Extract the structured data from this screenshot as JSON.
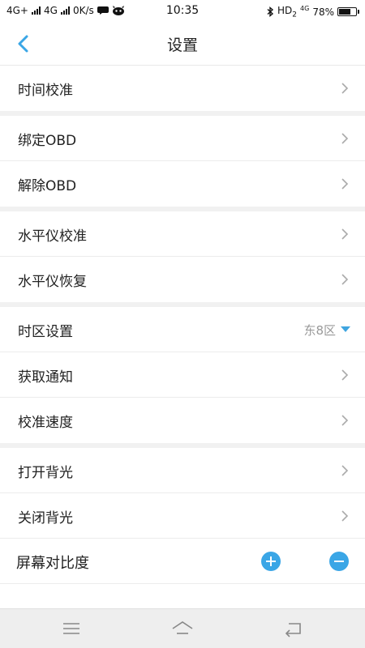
{
  "status_bar": {
    "network1": "4G+",
    "network2": "4G",
    "speed": "0K/s",
    "time": "10:35",
    "hd": "HD",
    "hd_sub": "2",
    "net4g": "4G",
    "battery": "78%",
    "battery_level": 0.78
  },
  "header": {
    "title": "设置",
    "back_icon": "chevron-left-icon"
  },
  "items": {
    "time_calibration": "时间校准",
    "bind_obd": "绑定OBD",
    "unbind_obd": "解除OBD",
    "level_calibration": "水平仪校准",
    "level_restore": "水平仪恢复",
    "timezone_setting": "时区设置",
    "timezone_value": "东8区",
    "get_notification": "获取通知",
    "speed_calibration": "校准速度",
    "backlight_on": "打开背光",
    "backlight_off": "关闭背光",
    "screen_contrast": "屏幕对比度"
  },
  "colors": {
    "accent": "#3aa6e6",
    "divider": "#ececec",
    "group_gap": "#f1f1f1"
  }
}
